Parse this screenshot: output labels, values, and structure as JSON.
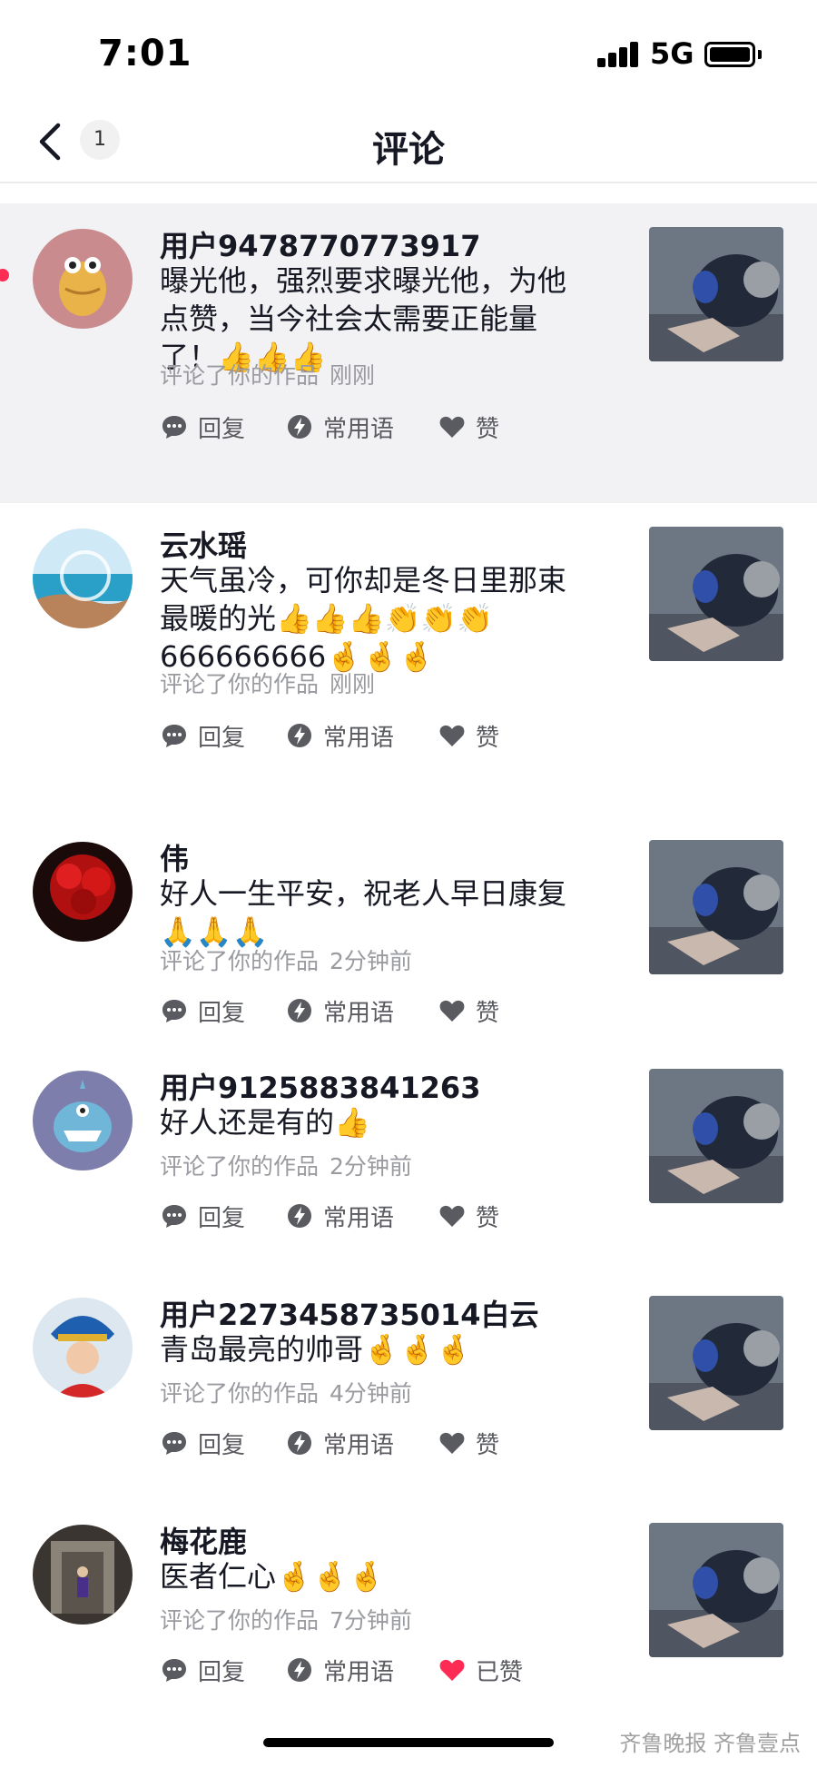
{
  "status_bar": {
    "time": "7:01",
    "network": "5G",
    "battery": "full"
  },
  "nav": {
    "title": "评论",
    "badge_count": "1",
    "back_icon": "chevron-left-icon"
  },
  "colors": {
    "accent_red": "#fe2c55",
    "highlight_bg": "#f2f2f4",
    "meta_gray": "#9a9ba0"
  },
  "comments": [
    {
      "username": "用户9478770773917",
      "text": "曝光他，强烈要求曝光他，为他点赞，当今社会太需要正能量了！👍👍👍",
      "meta_action": "评论了你的作品",
      "time": "刚刚",
      "reply_label": "回复",
      "phrase_label": "常用语",
      "like_label": "赞",
      "liked": false,
      "unread": true
    },
    {
      "username": "云水瑶",
      "text": "天气虽冷，可你却是冬日里那束最暖的光👍👍👍👏👏👏666666666🤞🤞🤞",
      "meta_action": "评论了你的作品",
      "time": "刚刚",
      "reply_label": "回复",
      "phrase_label": "常用语",
      "like_label": "赞",
      "liked": false,
      "unread": false
    },
    {
      "username": "伟",
      "text": "好人一生平安，祝老人早日康复🙏🙏🙏",
      "meta_action": "评论了你的作品",
      "time": "2分钟前",
      "reply_label": "回复",
      "phrase_label": "常用语",
      "like_label": "赞",
      "liked": false,
      "unread": false
    },
    {
      "username": "用户9125883841263",
      "text": "好人还是有的👍",
      "meta_action": "评论了你的作品",
      "time": "2分钟前",
      "reply_label": "回复",
      "phrase_label": "常用语",
      "like_label": "赞",
      "liked": false,
      "unread": false
    },
    {
      "username": "用户2273458735014白云",
      "text": "青岛最亮的帅哥🤞🤞🤞",
      "meta_action": "评论了你的作品",
      "time": "4分钟前",
      "reply_label": "回复",
      "phrase_label": "常用语",
      "like_label": "赞",
      "liked": false,
      "unread": false
    },
    {
      "username": "梅花鹿",
      "text": "医者仁心🤞🤞🤞",
      "meta_action": "评论了你的作品",
      "time": "7分钟前",
      "reply_label": "回复",
      "phrase_label": "常用语",
      "like_label": "已赞",
      "liked": true,
      "unread": false
    }
  ],
  "watermark": "齐鲁晚报 齐鲁壹点"
}
